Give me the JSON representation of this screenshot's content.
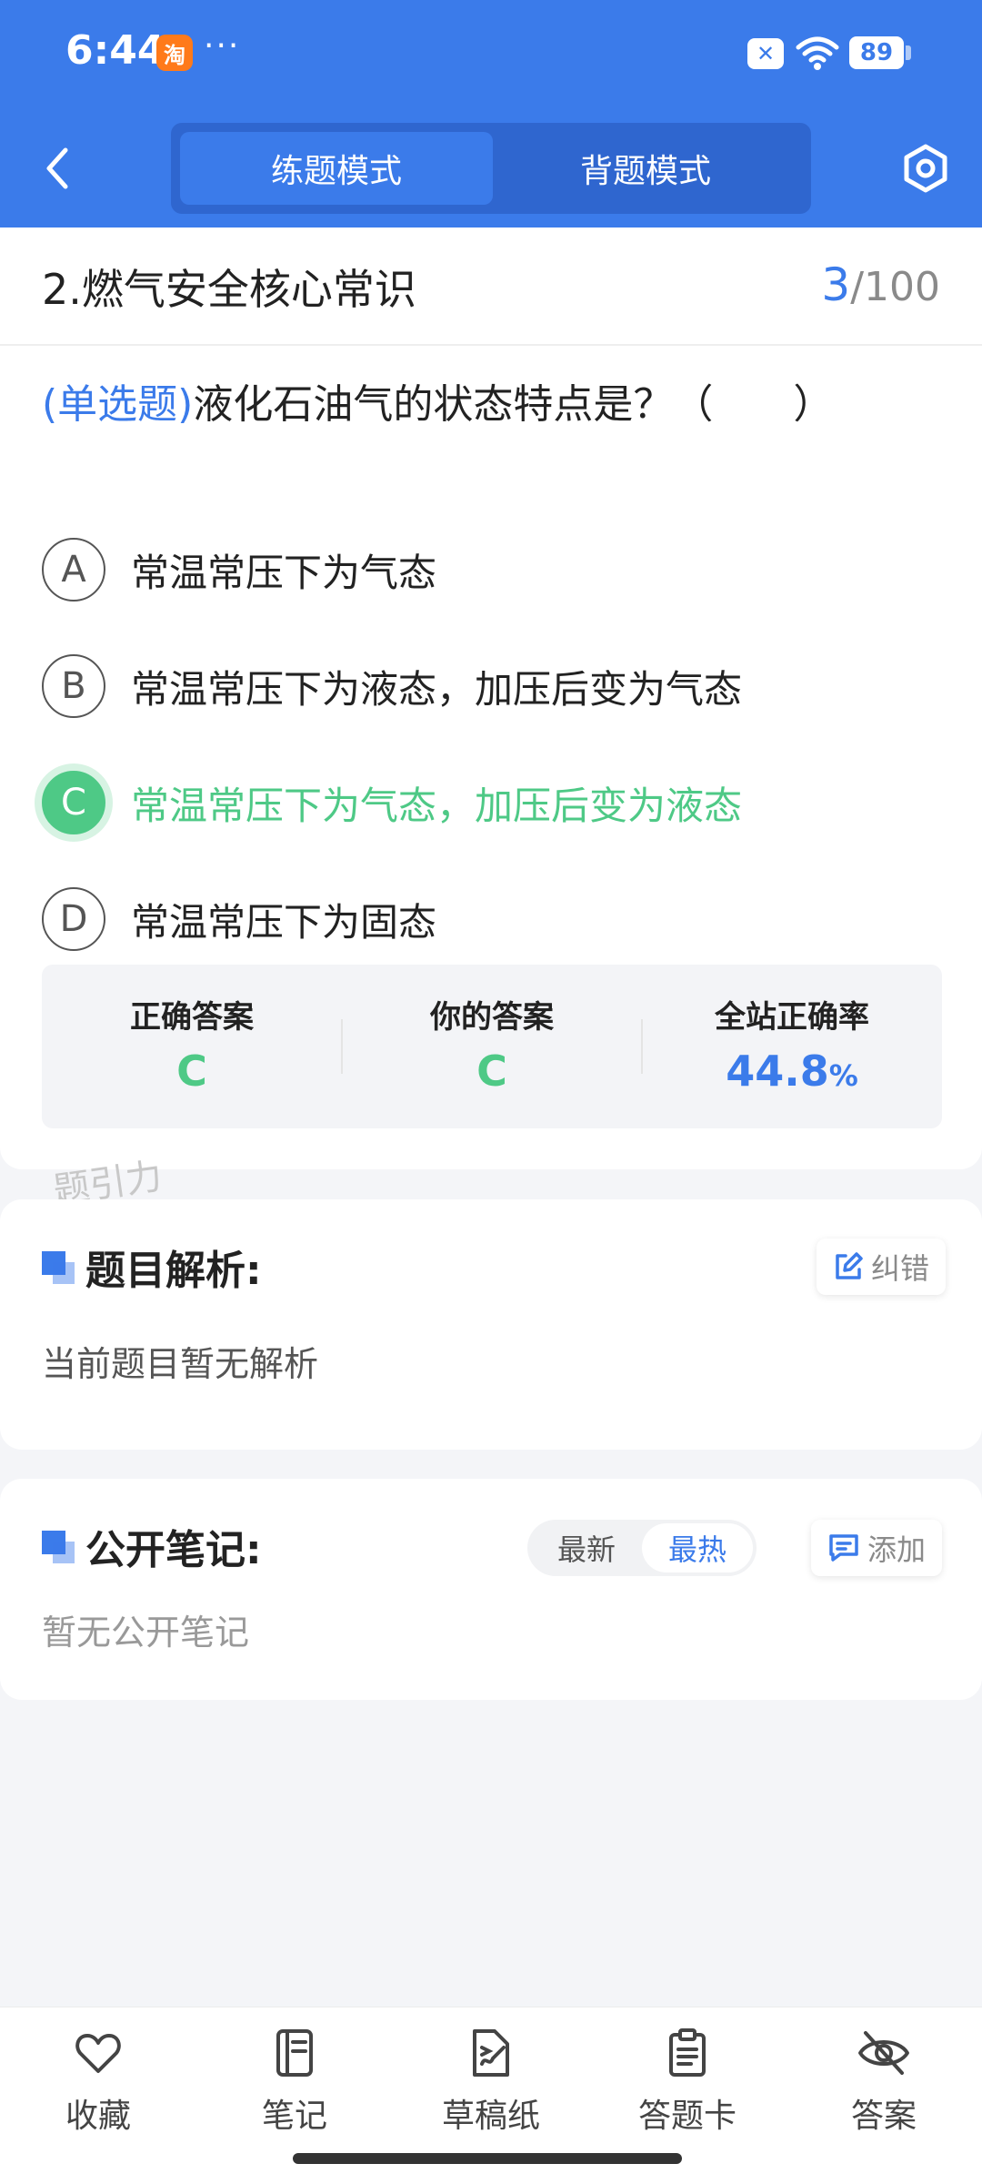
{
  "status_bar": {
    "time": "6:44",
    "app_icon_label": "淘",
    "dots": "···",
    "battery": "89"
  },
  "header": {
    "modes": [
      {
        "label": "练题模式",
        "active": true
      },
      {
        "label": "背题模式",
        "active": false
      }
    ]
  },
  "question": {
    "section_title": "2.燃气安全核心常识",
    "current": "3",
    "total": "/100",
    "type_label": "(单选题)",
    "text": "液化石油气的状态特点是？（　　）",
    "options": [
      {
        "letter": "A",
        "text": "常温常压下为气态"
      },
      {
        "letter": "B",
        "text": "常温常压下为液态，加压后变为气态"
      },
      {
        "letter": "C",
        "text": "常温常压下为气态，加压后变为液态",
        "correct": true
      },
      {
        "letter": "D",
        "text": "常温常压下为固态"
      }
    ],
    "answer_summary": {
      "correct_label": "正确答案",
      "correct_value": "C",
      "yours_label": "你的答案",
      "yours_value": "C",
      "rate_label": "全站正确率",
      "rate_value": "44.8",
      "rate_unit": "%"
    },
    "watermark": "题引力"
  },
  "analysis": {
    "title": "题目解析:",
    "report_label": "纠错",
    "body": "当前题目暂无解析"
  },
  "notes": {
    "title": "公开笔记:",
    "sort_options": [
      "最新",
      "最热"
    ],
    "add_label": "添加",
    "body": "暂无公开笔记"
  },
  "bottom_bar": {
    "items": [
      "收藏",
      "笔记",
      "草稿纸",
      "答题卡",
      "答案"
    ]
  },
  "colors": {
    "brand_blue": "#3b7bea",
    "correct_green": "#4ec986"
  }
}
